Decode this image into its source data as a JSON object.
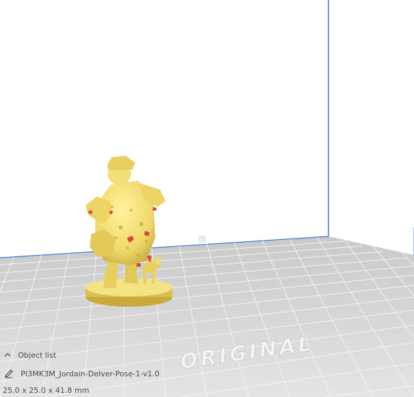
{
  "object_list": {
    "label": "Object list",
    "toggle_icon": "chevron-up-icon"
  },
  "selected_object": {
    "name": "PI3MK3M_Jordain-Delver-Pose-1-v1.0",
    "icon": "pencil-icon",
    "dimensions": "25.0 x 25.0 x 41.8 mm"
  },
  "buildplate_watermark": "ORIGINAL",
  "colors": {
    "background": "#ffffff",
    "buildplate": "#d9d9d9",
    "grid_line": "#ffffff",
    "axis_blue": "#3a74d6",
    "model_yellow": "#f2e07a",
    "model_shadow": "#c8a93a",
    "overhang_red": "#e0453a"
  }
}
